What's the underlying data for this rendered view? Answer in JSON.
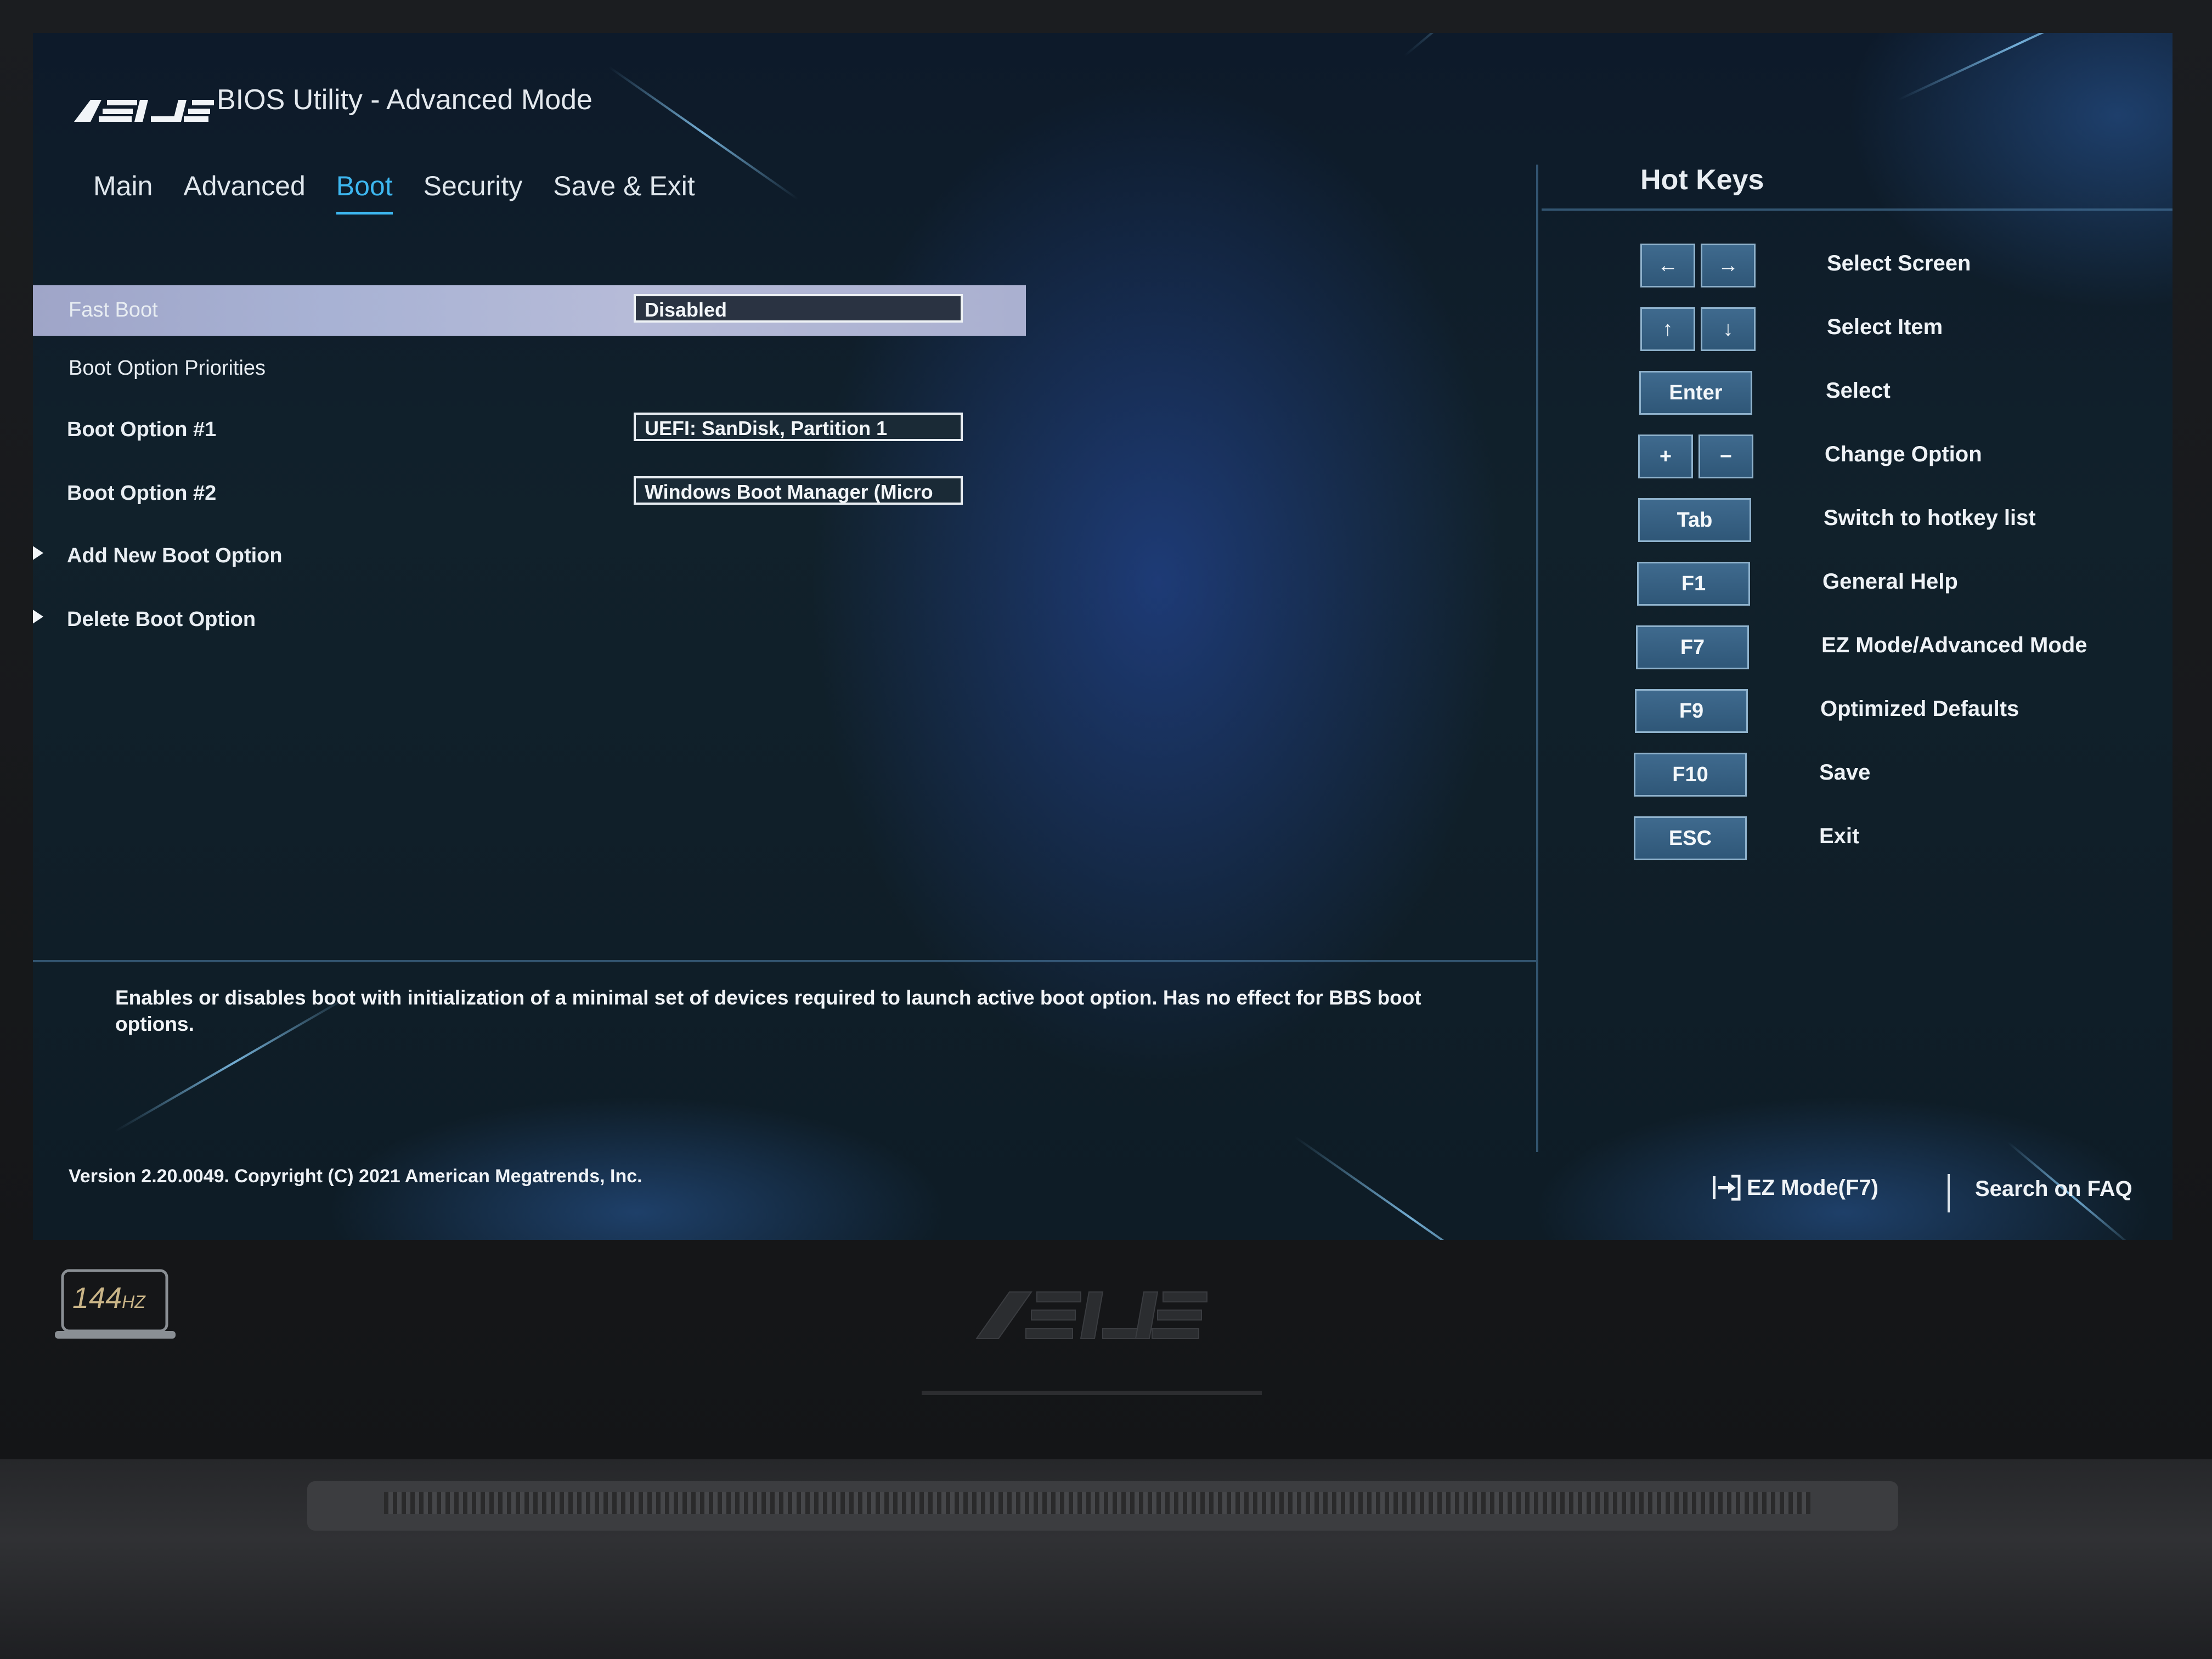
{
  "header": {
    "brand": "ASUS",
    "title": "BIOS Utility - Advanced Mode"
  },
  "tabs": [
    {
      "label": "Main",
      "active": false
    },
    {
      "label": "Advanced",
      "active": false
    },
    {
      "label": "Boot",
      "active": true
    },
    {
      "label": "Security",
      "active": false
    },
    {
      "label": "Save & Exit",
      "active": false
    }
  ],
  "boot": {
    "fast_boot": {
      "label": "Fast Boot",
      "value": "Disabled"
    },
    "priorities_heading": "Boot Option Priorities",
    "option1": {
      "label": "Boot Option #1",
      "value": "UEFI: SanDisk, Partition 1"
    },
    "option2": {
      "label": "Boot Option #2",
      "value": "Windows Boot Manager (Micro"
    },
    "add_option": "Add New Boot Option",
    "delete_option": "Delete Boot Option"
  },
  "help_text": "Enables or disables boot with initialization of a minimal set of devices required to launch active boot option. Has no effect for BBS boot options.",
  "hotkeys": {
    "title": "Hot Keys",
    "items": [
      {
        "keys": [
          "←",
          "→"
        ],
        "label": "Select Screen"
      },
      {
        "keys": [
          "↑",
          "↓"
        ],
        "label": "Select Item"
      },
      {
        "keys": [
          "Enter"
        ],
        "label": "Select"
      },
      {
        "keys": [
          "+",
          "−"
        ],
        "label": "Change Option"
      },
      {
        "keys": [
          "Tab"
        ],
        "label": "Switch to hotkey list"
      },
      {
        "keys": [
          "F1"
        ],
        "label": "General Help"
      },
      {
        "keys": [
          "F7"
        ],
        "label": "EZ Mode/Advanced Mode"
      },
      {
        "keys": [
          "F9"
        ],
        "label": "Optimized Defaults"
      },
      {
        "keys": [
          "F10"
        ],
        "label": "Save"
      },
      {
        "keys": [
          "ESC"
        ],
        "label": "Exit"
      }
    ]
  },
  "footer": {
    "version": "Version 2.20.0049. Copyright (C) 2021 American Megatrends, Inc.",
    "ez_mode": "EZ Mode(F7)",
    "search_faq": "Search on FAQ"
  },
  "hardware": {
    "refresh_badge_number": "144",
    "refresh_badge_unit": "HZ",
    "chassis_brand": "ASUS"
  },
  "colors": {
    "accent": "#3db7f0",
    "key_fill": "#2f5778",
    "highlight_row": "#a8b2d4"
  }
}
